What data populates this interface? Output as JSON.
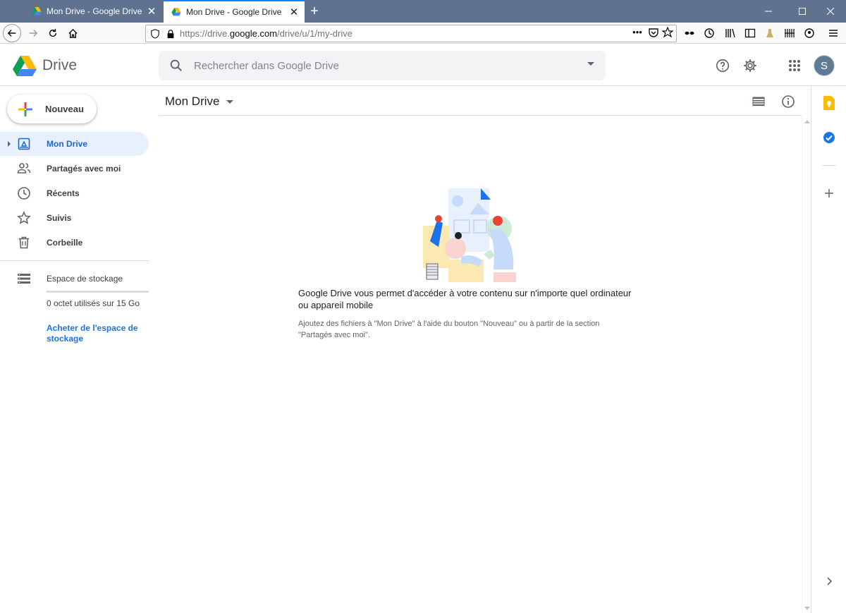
{
  "browser": {
    "tabs": [
      {
        "title": "Mon Drive - Google Drive",
        "active": false
      },
      {
        "title": "Mon Drive - Google Drive",
        "active": true
      }
    ],
    "url_prefix": "https://drive.",
    "url_domain": "google.com",
    "url_path": "/drive/u/1/my-drive",
    "url_menu": "•••"
  },
  "header": {
    "app_name": "Drive",
    "search_placeholder": "Rechercher dans Google Drive",
    "avatar_initial": "S"
  },
  "sidebar": {
    "new_label": "Nouveau",
    "items": [
      {
        "label": "Mon Drive",
        "icon": "my-drive-icon",
        "active": true
      },
      {
        "label": "Partagés avec moi",
        "icon": "shared-icon"
      },
      {
        "label": "Récents",
        "icon": "recent-clock-icon"
      },
      {
        "label": "Suivis",
        "icon": "star-icon"
      },
      {
        "label": "Corbeille",
        "icon": "trash-icon"
      }
    ],
    "storage_label": "Espace de stockage",
    "storage_used": "0 octet utilisés sur 15 Go",
    "storage_fraction": 0,
    "buy_storage": "Acheter de l'espace de stockage"
  },
  "main": {
    "breadcrumb": "Mon Drive",
    "empty_title": "Google Drive vous permet d'accéder à votre contenu sur n'importe quel ordinateur ou appareil mobile",
    "empty_sub": "Ajoutez des fichiers à \"Mon Drive\" à l'aide du bouton \"Nouveau\" ou à partir de la section \"Partagés avec moi\"."
  },
  "colors": {
    "accent": "#1a73e8",
    "active_bg": "#e8f0fe",
    "active_text": "#1967d2",
    "tabbar": "#5f7390"
  }
}
